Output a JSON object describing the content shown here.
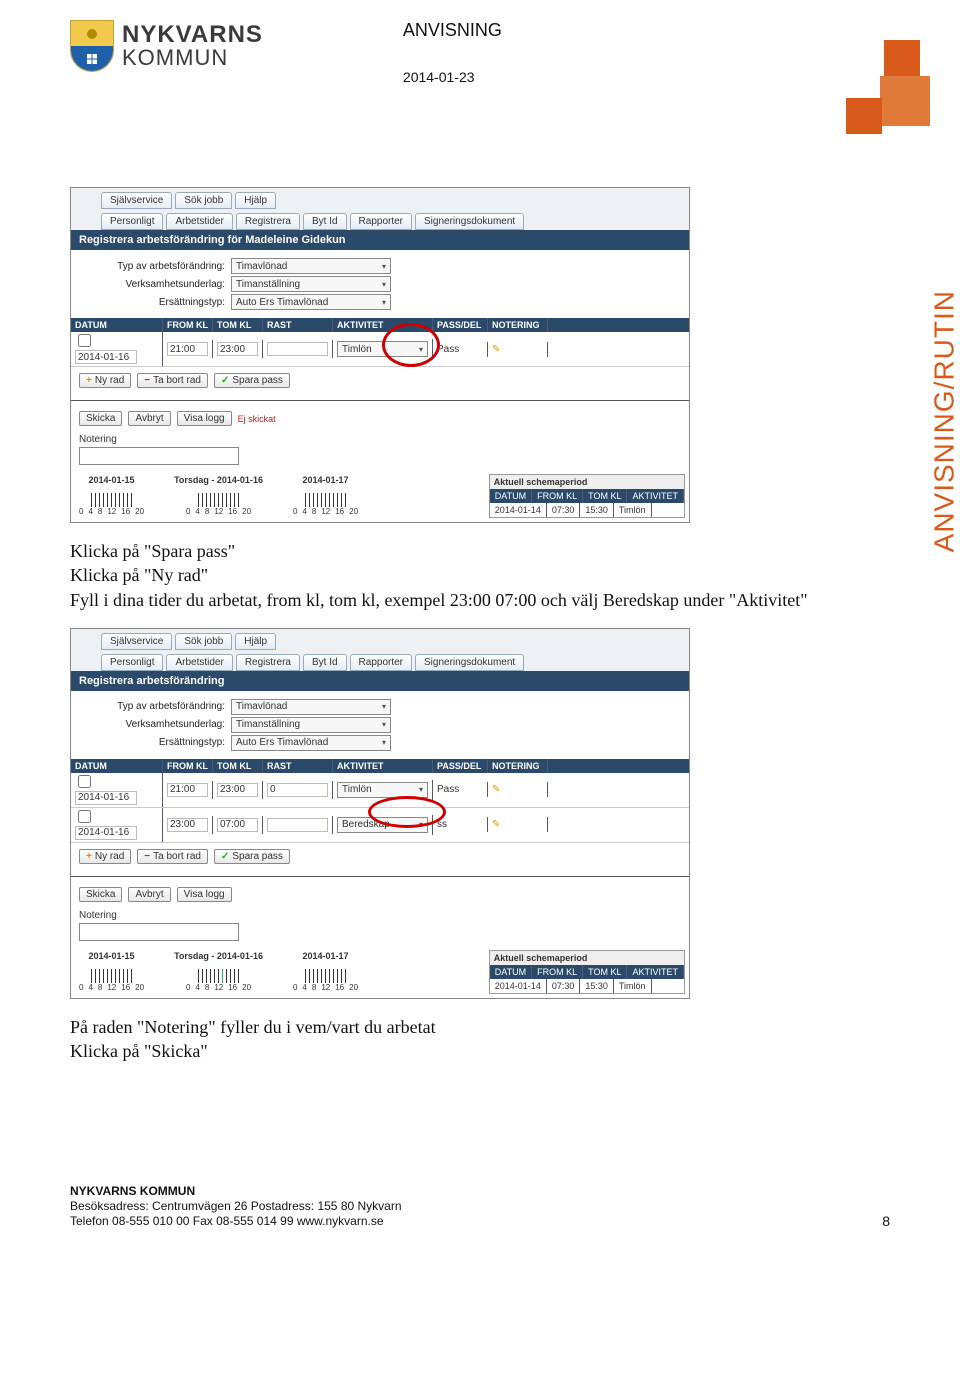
{
  "header": {
    "org_line1": "NYKVARNS",
    "org_line2": "KOMMUN",
    "doc_title": "ANVISNING",
    "doc_date": "2014-01-23"
  },
  "side_label": "ANVISNING/RUTIN",
  "body": {
    "para1_line1": "Klicka på \"Spara pass\"",
    "para1_line2": "Klicka på \"Ny rad\"",
    "para1_line3": "Fyll i dina tider du arbetat, from kl, tom kl, exempel 23:00 07:00 och välj Beredskap under \"Aktivitet\"",
    "para2_line1": "På raden \"Notering\" fyller du i vem/vart du arbetat",
    "para2_line2": "Klicka på \"Skicka\""
  },
  "app": {
    "tabs_row1": [
      "Självservice",
      "Sök jobb",
      "Hjälp"
    ],
    "tabs_row2": [
      "Personligt",
      "Arbetstider",
      "Registrera",
      "Byt Id",
      "Rapporter",
      "Signeringsdokument"
    ],
    "panel1_title": "Registrera arbetsförändring för Madeleine Gidekun",
    "panel2_title": "Registrera arbetsförändring",
    "form_labels": {
      "typ": "Typ av arbetsförändring:",
      "verk": "Verksamhetsunderlag:",
      "ers": "Ersättningstyp:"
    },
    "form_values": {
      "typ": "Timavlönad",
      "verk": "Timanställning",
      "ers": "Auto Ers Timavlönad"
    },
    "grid_headers": [
      "DATUM",
      "FROM KL",
      "TOM KL",
      "RAST",
      "AKTIVITET",
      "PASS/DEL",
      "NOTERING"
    ],
    "grid1_rows": [
      {
        "datum": "2014-01-16",
        "from": "21:00",
        "tom": "23:00",
        "rast": "",
        "aktivitet": "Timlön",
        "pass": "Pass"
      }
    ],
    "grid2_rows": [
      {
        "datum": "2014-01-16",
        "from": "21:00",
        "tom": "23:00",
        "rast": "0",
        "aktivitet": "Timlön",
        "pass": "Pass"
      },
      {
        "datum": "2014-01-16",
        "from": "23:00",
        "tom": "07:00",
        "rast": "",
        "aktivitet": "Beredskap",
        "pass": "ss"
      }
    ],
    "action_btns": {
      "ny": "Ny rad",
      "del": "Ta bort rad",
      "save": "Spara pass"
    },
    "lower_btns": {
      "send": "Skicka",
      "cancel": "Avbryt",
      "log": "Visa logg"
    },
    "ej_skickat": "Ej skickat",
    "note_label": "Notering",
    "timeline_days": [
      "2014-01-15",
      "Torsdag - 2014-01-16",
      "2014-01-17"
    ],
    "timeline_nums": [
      "0",
      "4",
      "8",
      "12",
      "16",
      "20"
    ],
    "right_panel": {
      "title": "Aktuell schemaperiod",
      "headers": [
        "DATUM",
        "FROM KL",
        "TOM KL",
        "AKTIVITET"
      ],
      "row": [
        "2014-01-14",
        "07:30",
        "15:30",
        "Timlön"
      ]
    }
  },
  "footer": {
    "line1": "NYKVARNS KOMMUN",
    "line2": "Besöksadress: Centrumvägen 26  Postadress: 155 80 Nykvarn",
    "line3": "Telefon 08-555 010 00  Fax 08-555 014 99  www.nykvarn.se",
    "page": "8"
  }
}
